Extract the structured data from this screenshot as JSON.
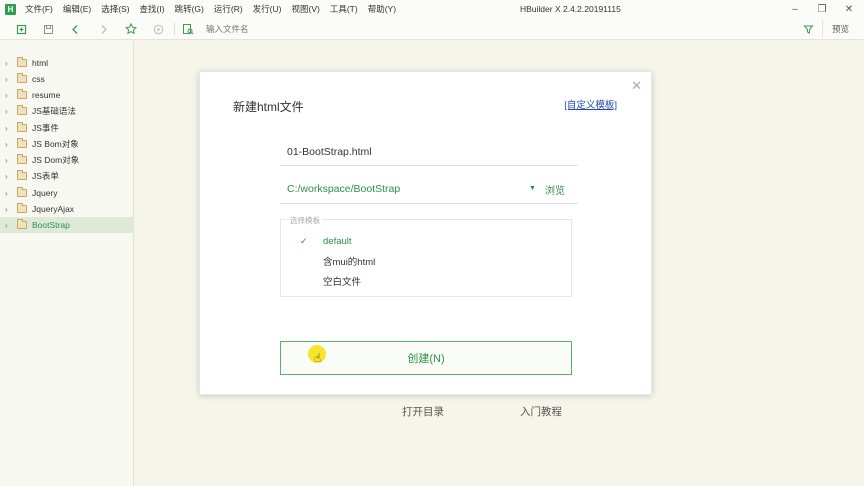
{
  "app": {
    "logo_letter": "H",
    "window_title": "HBuilder X 2.4.2.20191115",
    "menu": [
      "文件(F)",
      "编辑(E)",
      "选择(S)",
      "查找(I)",
      "跳转(G)",
      "运行(R)",
      "发行(U)",
      "视图(V)",
      "工具(T)",
      "帮助(Y)"
    ]
  },
  "toolbar": {
    "file_search_placeholder": "输入文件名",
    "preview_label": "预览",
    "icons": [
      "new-file-icon",
      "save-icon",
      "back-icon",
      "forward-icon",
      "star-icon",
      "run-icon",
      "browser-preview-icon",
      "filter-icon"
    ]
  },
  "sidebar": {
    "items": [
      {
        "label": "html",
        "active": false
      },
      {
        "label": "css",
        "active": false
      },
      {
        "label": "resume",
        "active": false
      },
      {
        "label": "JS基础语法",
        "active": false
      },
      {
        "label": "JS事件",
        "active": false
      },
      {
        "label": "JS Bom对象",
        "active": false
      },
      {
        "label": "JS Dom对象",
        "active": false
      },
      {
        "label": "JS表单",
        "active": false
      },
      {
        "label": "Jquery",
        "active": false
      },
      {
        "label": "JqueryAjax",
        "active": false
      },
      {
        "label": "BootStrap",
        "active": true
      }
    ]
  },
  "welcome": {
    "open_directory": "打开目录",
    "tutorial": "入门教程"
  },
  "dialog": {
    "title": "新建html文件",
    "custom_template_link": "[自定义模板]",
    "filename_value": "01-BootStrap.html",
    "path_value": "C:/workspace/BootStrap",
    "browse_label": "浏览",
    "template_legend": "选择模板",
    "templates": [
      {
        "label": "default",
        "selected": true
      },
      {
        "label": "含mui的html",
        "selected": false
      },
      {
        "label": "空白文件",
        "selected": false
      }
    ],
    "create_button": "创建(N)"
  }
}
